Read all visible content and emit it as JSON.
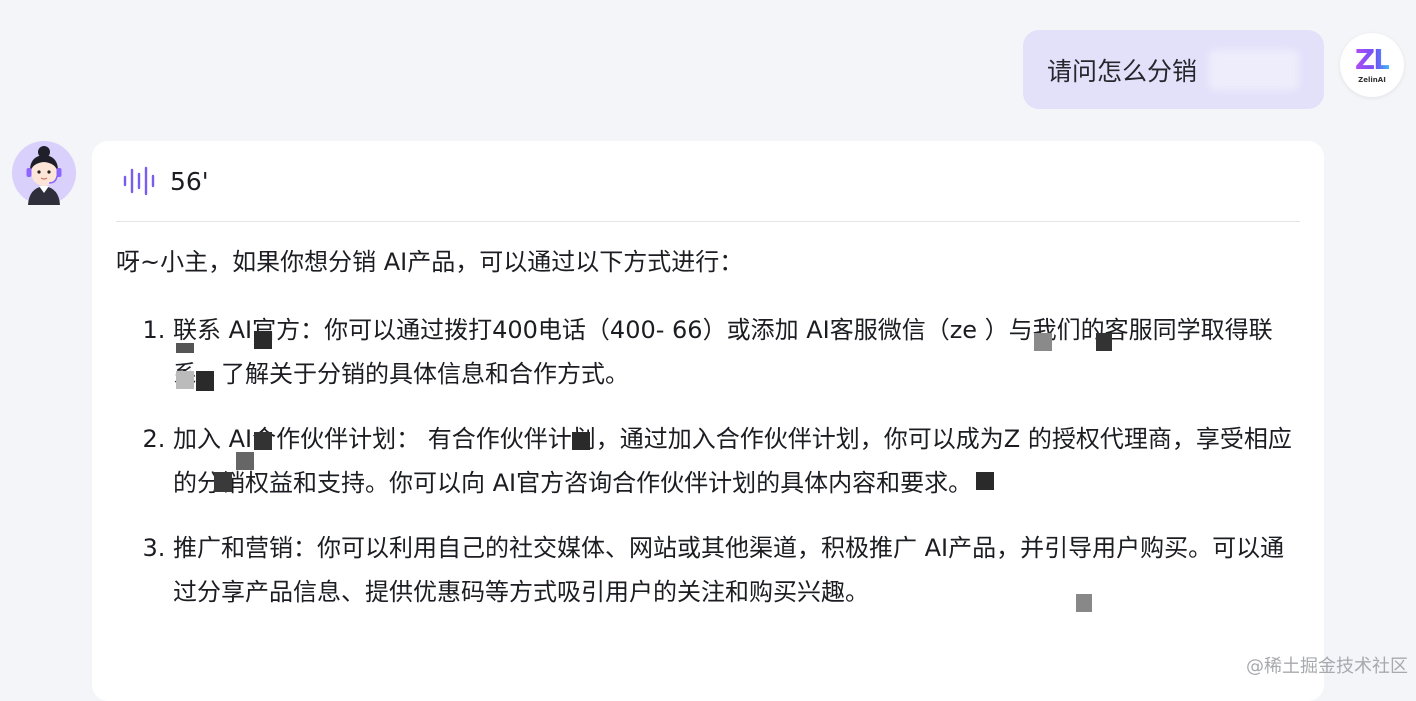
{
  "user_message": {
    "text": "请问怎么分销",
    "avatar": {
      "logo": "ZL",
      "caption": "ZelinAI"
    }
  },
  "assistant": {
    "voice": {
      "icon": "sound-wave-icon",
      "duration": "56'"
    },
    "intro": "呀~小主，如果你想分销 AI产品，可以通过以下方式进行：",
    "points": [
      "联系 AI官方：你可以通过拨打400电话（400- 66）或添加 AI客服微信（ze ）与我们的客服同学取得联系，了解关于分销的具体信息和合作方式。",
      "加入 AI合作伙伴计划： 有合作伙伴计划，通过加入合作伙伴计划，你可以成为Z 的授权代理商，享受相应的分销权益和支持。你可以向 AI官方咨询合作伙伴计划的具体内容和要求。",
      "推广和营销：你可以利用自己的社交媒体、网站或其他渠道，积极推广 AI产品，并引导用户购买。可以通过分享产品信息、提供优惠码等方式吸引用户的关注和购买兴趣。"
    ]
  },
  "watermark": "@稀土掘金技术社区",
  "colors": {
    "page_bg": "#f4f5f8",
    "user_bubble": "#e3e1fa",
    "card_bg": "#ffffff",
    "accent": "#7a5cf0"
  }
}
